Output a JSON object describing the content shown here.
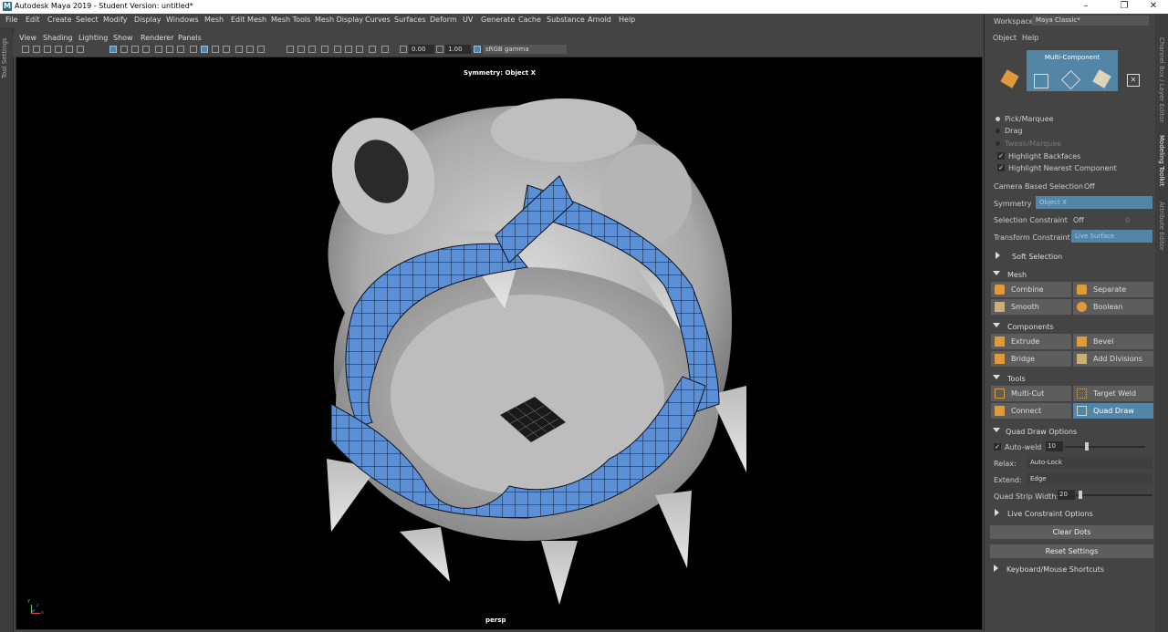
{
  "window": {
    "title": "Autodesk Maya 2019 - Student Version: untitled*",
    "logo": "M",
    "controls": [
      "–",
      "❐",
      "✕"
    ]
  },
  "menu": [
    "File",
    "Edit",
    "Create",
    "Select",
    "Modify",
    "Display",
    "Windows",
    "Mesh",
    "Edit Mesh",
    "Mesh Tools",
    "Mesh Display",
    "Curves",
    "Surfaces",
    "Deform",
    "UV",
    "Generate",
    "Cache",
    "Substance",
    "Arnold",
    "Help"
  ],
  "left_strip": {
    "label": "Tool Settings"
  },
  "panel_menu": [
    "View",
    "Shading",
    "Lighting",
    "Show",
    "Renderer",
    "Panels"
  ],
  "panel_toolbar": {
    "exposure": "0.00",
    "gamma": "1.00",
    "color_space": "sRGB gamma"
  },
  "viewport": {
    "symmetry_label": "Symmetry: Object X",
    "camera_label": "persp",
    "axis": {
      "x": "x",
      "y": "y",
      "z": "z"
    },
    "colors": {
      "mesh": "#c9c9c9",
      "retopo": "#5b8fd6",
      "background": "#000000"
    }
  },
  "workspace": {
    "label": "Workspace :",
    "value": "Maya Classic*"
  },
  "toolkit": {
    "menu": [
      "Object",
      "Help"
    ],
    "mode_title": "Multi-Component",
    "selection_modes": [
      {
        "label": "Pick/Marquee",
        "selected": true
      },
      {
        "label": "Drag",
        "selected": false
      },
      {
        "label": "Tweak/Marquee",
        "selected": false,
        "disabled": true
      }
    ],
    "checks": [
      {
        "label": "Highlight Backfaces",
        "checked": true
      },
      {
        "label": "Highlight Nearest Component",
        "checked": true
      }
    ],
    "camera_based": {
      "label": "Camera Based Selection",
      "value": "Off"
    },
    "symmetry": {
      "label": "Symmetry",
      "value": "Object X"
    },
    "selection_constraint": {
      "label": "Selection Constraint",
      "value": "Off",
      "extra": "0"
    },
    "transform_constraint": {
      "label": "Transform Constraint",
      "value": "Live Surface"
    },
    "soft_selection": "Soft Selection",
    "sections": {
      "mesh": {
        "title": "Mesh",
        "buttons": [
          "Combine",
          "Separate",
          "Smooth",
          "Boolean"
        ]
      },
      "components": {
        "title": "Components",
        "buttons": [
          "Extrude",
          "Bevel",
          "Bridge",
          "Add Divisions"
        ]
      },
      "tools": {
        "title": "Tools",
        "buttons": [
          "Multi-Cut",
          "Target Weld",
          "Connect",
          "Quad Draw"
        ],
        "active": "Quad Draw"
      }
    },
    "quad_draw": {
      "title": "Quad Draw Options",
      "auto_weld": {
        "label": "Auto-weld",
        "value": "10",
        "checked": true
      },
      "relax": {
        "label": "Relax:",
        "value": "Auto-Lock"
      },
      "extend": {
        "label": "Extend:",
        "value": "Edge"
      },
      "strip_width": {
        "label": "Quad Strip Width:",
        "value": "20"
      }
    },
    "live_constraint": "Live Constraint Options",
    "clear_dots": "Clear Dots",
    "reset_settings": "Reset Settings",
    "shortcuts": "Keyboard/Mouse Shortcuts"
  },
  "side_tabs": [
    "Channel Box / Layer Editor",
    "Modeling Toolkit",
    "Attribute Editor"
  ]
}
